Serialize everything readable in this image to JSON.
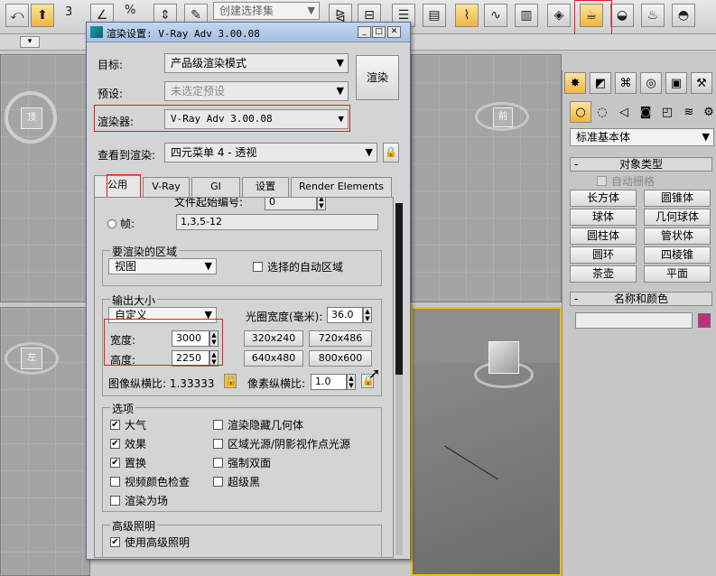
{
  "toolbar": {
    "snap_label": "3",
    "percent_label": "%",
    "selection_set_placeholder": "创建选择集"
  },
  "viewports": {
    "top_left_cube_label": "顶",
    "top_right_cube_label": "前",
    "bottom_left_cube_label": "左"
  },
  "command_panel": {
    "dropdown_value": "标准基本体",
    "object_type_title": "对象类型",
    "autogrid_label": "自动栅格",
    "object_buttons": [
      "长方体",
      "圆锥体",
      "球体",
      "几何球体",
      "圆柱体",
      "管状体",
      "圆环",
      "四棱锥",
      "茶壶",
      "平面"
    ],
    "name_color_title": "名称和颜色",
    "object_color": "#c0307a"
  },
  "dialog": {
    "title": "渲染设置: V-Ray Adv 3.00.08",
    "target_label": "目标:",
    "target_value": "产品级渲染模式",
    "preset_label": "预设:",
    "preset_value": "未选定预设",
    "renderer_label": "渲染器:",
    "renderer_value": "V-Ray Adv 3.00.08",
    "view_label": "查看到渲染:",
    "view_value": "四元菜单 4 - 透视",
    "render_button": "渲染",
    "tabs": [
      "公用",
      "V-Ray",
      "GI",
      "设置",
      "Render Elements"
    ],
    "file_start_label": "文件起始编号:",
    "file_start_value": "0",
    "frames_label": "帧:",
    "frames_value": "1,3,5-12",
    "area_group": "要渲染的区域",
    "area_value": "视图",
    "auto_region_label": "选择的自动区域",
    "output_group": "输出大小",
    "output_preset": "自定义",
    "aperture_label": "光圈宽度(毫米):",
    "aperture_value": "36.0",
    "width_label": "宽度:",
    "width_value": "3000",
    "height_label": "高度:",
    "height_value": "2250",
    "size_buttons": [
      "320x240",
      "720x486",
      "640x480",
      "800x600"
    ],
    "image_aspect_label": "图像纵横比: 1.33333",
    "pixel_aspect_label": "像素纵横比:",
    "pixel_aspect_value": "1.0",
    "options_group": "选项",
    "options_left": [
      {
        "label": "大气",
        "checked": "✔"
      },
      {
        "label": "效果",
        "checked": "✔"
      },
      {
        "label": "置换",
        "checked": "✔"
      },
      {
        "label": "视频颜色检查",
        "checked": ""
      },
      {
        "label": "渲染为场",
        "checked": ""
      }
    ],
    "options_right": [
      {
        "label": "渲染隐藏几何体",
        "checked": ""
      },
      {
        "label": "区域光源/阴影视作点光源",
        "checked": ""
      },
      {
        "label": "强制双面",
        "checked": ""
      },
      {
        "label": "超级黑",
        "checked": ""
      }
    ],
    "gi_group": "高级照明",
    "use_gi_label": "使用高级照明",
    "use_gi_checked": "✔"
  },
  "colors": {
    "highlight_red": "#e02020",
    "active_viewport": "#f0c000"
  }
}
